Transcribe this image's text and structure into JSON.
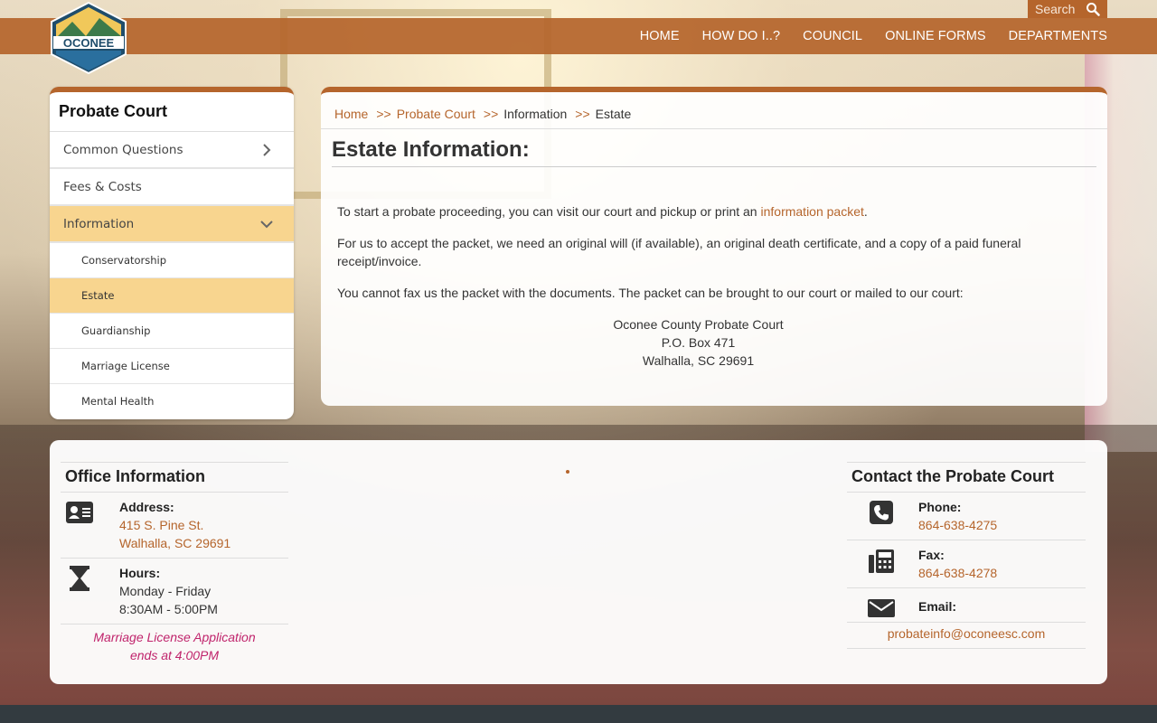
{
  "header": {
    "logo_text": "OCONEE",
    "search_label": "Search",
    "nav": [
      "HOME",
      "HOW DO I..?",
      "COUNCIL",
      "ONLINE FORMS",
      "DEPARTMENTS"
    ]
  },
  "sidebar": {
    "title": "Probate Court",
    "items": [
      {
        "label": "Common Questions"
      },
      {
        "label": "Fees & Costs"
      },
      {
        "label": "Information"
      }
    ],
    "subitems": [
      {
        "label": "Conservatorship"
      },
      {
        "label": "Estate"
      },
      {
        "label": "Guardianship"
      },
      {
        "label": "Marriage License"
      },
      {
        "label": "Mental Health"
      }
    ]
  },
  "breadcrumb": {
    "home": "Home",
    "probate": "Probate Court",
    "information": "Information",
    "current": "Estate",
    "separator": ">>"
  },
  "main": {
    "title": "Estate Information:",
    "p1_before": "To start a probate proceeding, you can visit our court and pickup or print an ",
    "p1_link": "information packet",
    "p1_after": ".",
    "p2": "For us to accept the packet, we need an original will (if available), an original death certificate, and a copy of a paid funeral receipt/invoice.",
    "p3": "You cannot fax us the packet with the documents. The packet can be brought to our court or mailed to our court:",
    "address": [
      "Oconee County Probate Court",
      "P.O. Box 471",
      "Walhalla, SC 29691"
    ]
  },
  "office": {
    "title": "Office Information",
    "address_label": "Address:",
    "address_line1": "415 S. Pine St.",
    "address_line2": "Walhalla, SC 29691",
    "hours_label": "Hours:",
    "hours_days": "Monday - Friday",
    "hours_time": "8:30AM - 5:00PM",
    "note_line1": "Marriage License Application",
    "note_line2": "ends at 4:00PM"
  },
  "contact": {
    "title": "Contact the Probate Court",
    "phone_label": "Phone:",
    "phone": "864-638-4275",
    "fax_label": "Fax:",
    "fax": "864-638-4278",
    "email_label": "Email:",
    "email": "probateinfo@oconeesc.com"
  },
  "colors": {
    "accent": "#b5652c",
    "active_bg": "#f8d58f",
    "note": "#c0246c"
  }
}
